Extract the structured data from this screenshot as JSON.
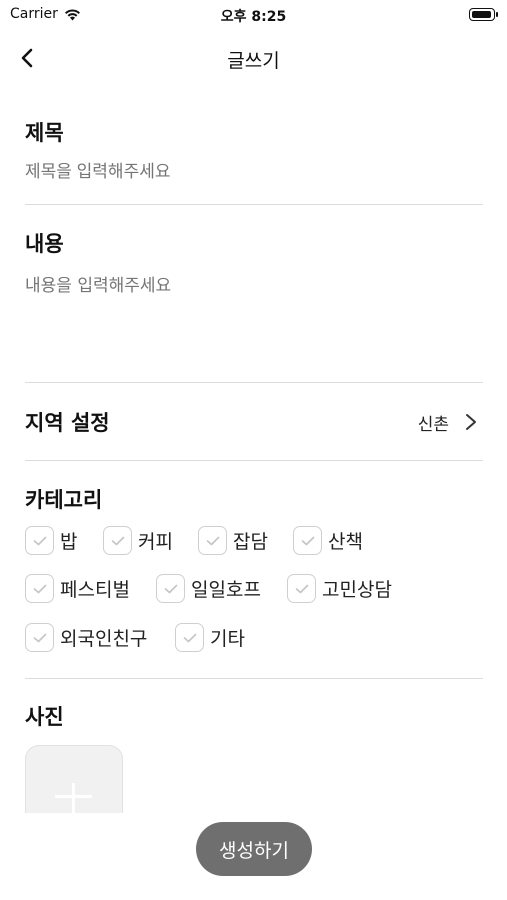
{
  "status_bar": {
    "carrier": "Carrier",
    "time": "오후 8:25"
  },
  "nav": {
    "title": "글쓰기",
    "back_icon": "chevron-left-icon"
  },
  "title_section": {
    "label": "제목",
    "placeholder": "제목을 입력해주세요"
  },
  "content_section": {
    "label": "내용",
    "placeholder": "내용을 입력해주세요"
  },
  "region_section": {
    "label": "지역 설정",
    "value": "신촌",
    "chevron_icon": "chevron-right-icon"
  },
  "category_section": {
    "label": "카테고리",
    "items": [
      {
        "label": "밥",
        "checked": false
      },
      {
        "label": "커피",
        "checked": false
      },
      {
        "label": "잡담",
        "checked": false
      },
      {
        "label": "산책",
        "checked": false
      },
      {
        "label": "페스티벌",
        "checked": false
      },
      {
        "label": "일일호프",
        "checked": false
      },
      {
        "label": "고민상담",
        "checked": false
      },
      {
        "label": "외국인친구",
        "checked": false
      },
      {
        "label": "기타",
        "checked": false
      }
    ]
  },
  "photo_section": {
    "label": "사진",
    "add_icon": "plus-icon"
  },
  "submit": {
    "label": "생성하기"
  },
  "colors": {
    "divider": "#dcdcdc",
    "placeholder": "#8a8a8a",
    "button": "#6f6f6f",
    "checkbox_border": "#cfcfcf"
  }
}
